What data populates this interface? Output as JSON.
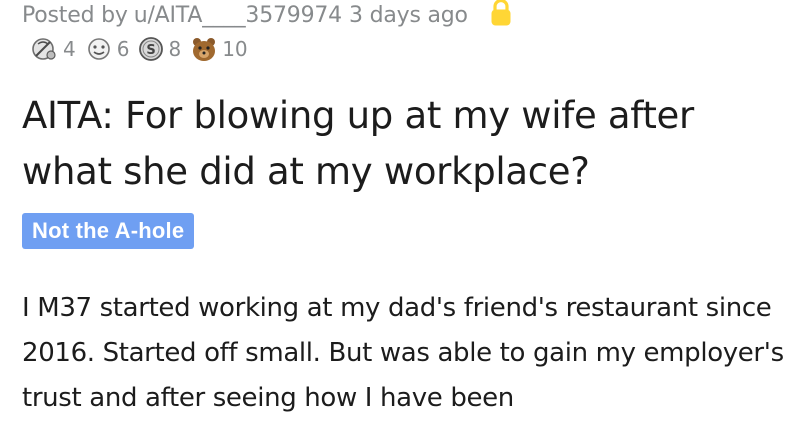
{
  "post": {
    "posted_by_prefix": "Posted by",
    "username": "u/AITA____3579974",
    "time_ago": "3 days ago",
    "locked_icon": "lock-icon",
    "awards": [
      {
        "icon": "wholesome-award-icon",
        "count": "4"
      },
      {
        "icon": "helpful-award-icon",
        "count": "6"
      },
      {
        "icon": "silver-award-icon",
        "count": "8"
      },
      {
        "icon": "bear-award-icon",
        "count": "10"
      }
    ],
    "title": "AITA: For blowing up at my wife after what she did at my workplace?",
    "flair": "Not the A-hole",
    "body": "I M37 started working at my dad's friend's restaurant since 2016. Started off small. But was able to gain my employer's trust and after seeing how I have been"
  },
  "colors": {
    "meta_text": "#878a8c",
    "title_text": "#1c1c1c",
    "flair_bg": "#6f9ff2",
    "lock": "#ffd635"
  }
}
